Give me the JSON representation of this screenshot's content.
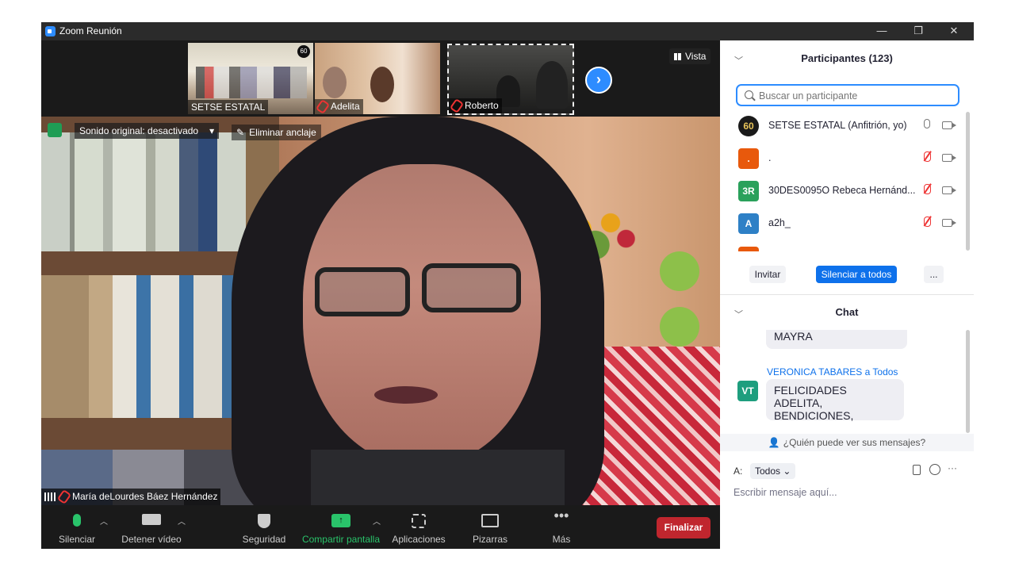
{
  "window": {
    "title": "Zoom Reunión",
    "controls": {
      "minimize": "—",
      "restore": "❐",
      "close": "✕"
    }
  },
  "thumbnails": [
    {
      "name": "SETSE ESTATAL",
      "muted": false
    },
    {
      "name": "Adelita",
      "muted": true
    },
    {
      "name": "Roberto",
      "muted": true
    }
  ],
  "view_label": "Vista",
  "main_video": {
    "audio_label": "Sonido original: desactivado",
    "unpin_label": "Eliminar anclaje",
    "speaker_name": "María deLourdes Báez Hernández"
  },
  "toolbar": {
    "mute": "Silenciar",
    "stop_video": "Detener vídeo",
    "security": "Seguridad",
    "share_screen": "Compartir pantalla",
    "apps": "Aplicaciones",
    "whiteboards": "Pizarras",
    "more": "Más",
    "end": "Finalizar"
  },
  "participants_panel": {
    "title": "Participantes (123)",
    "search_placeholder": "Buscar un participante",
    "participants": [
      {
        "avatar": "60",
        "avatar_color": "#1a1a1a",
        "name": "SETSE ESTATAL (Anfitrión, yo)",
        "muted": false
      },
      {
        "avatar": ".",
        "avatar_color": "#e8590c",
        "name": ".",
        "muted": true
      },
      {
        "avatar": "3R",
        "avatar_color": "#2aa15b",
        "name": "30DES0095O  Rebeca Hernánd...",
        "muted": true
      },
      {
        "avatar": "A",
        "avatar_color": "#2e80c6",
        "name": "a2h_",
        "muted": true
      }
    ],
    "invite": "Invitar",
    "mute_all": "Silenciar a todos",
    "more": "..."
  },
  "chat": {
    "title": "Chat",
    "prev_message": "MAYRA",
    "sender": "VERONICA TABARES",
    "to_label": "a Todos",
    "sender_initials": "VT",
    "sender_color": "#1e9e7e",
    "message_line1": "FELICIDADES ADELITA,",
    "message_line2": "BENDICIONES,",
    "who_can_see": "¿Quién puede ver sus mensajes?",
    "to_prefix": "A:",
    "recipient": "Todos",
    "input_placeholder": "Escribir mensaje aquí...",
    "more": "···"
  }
}
